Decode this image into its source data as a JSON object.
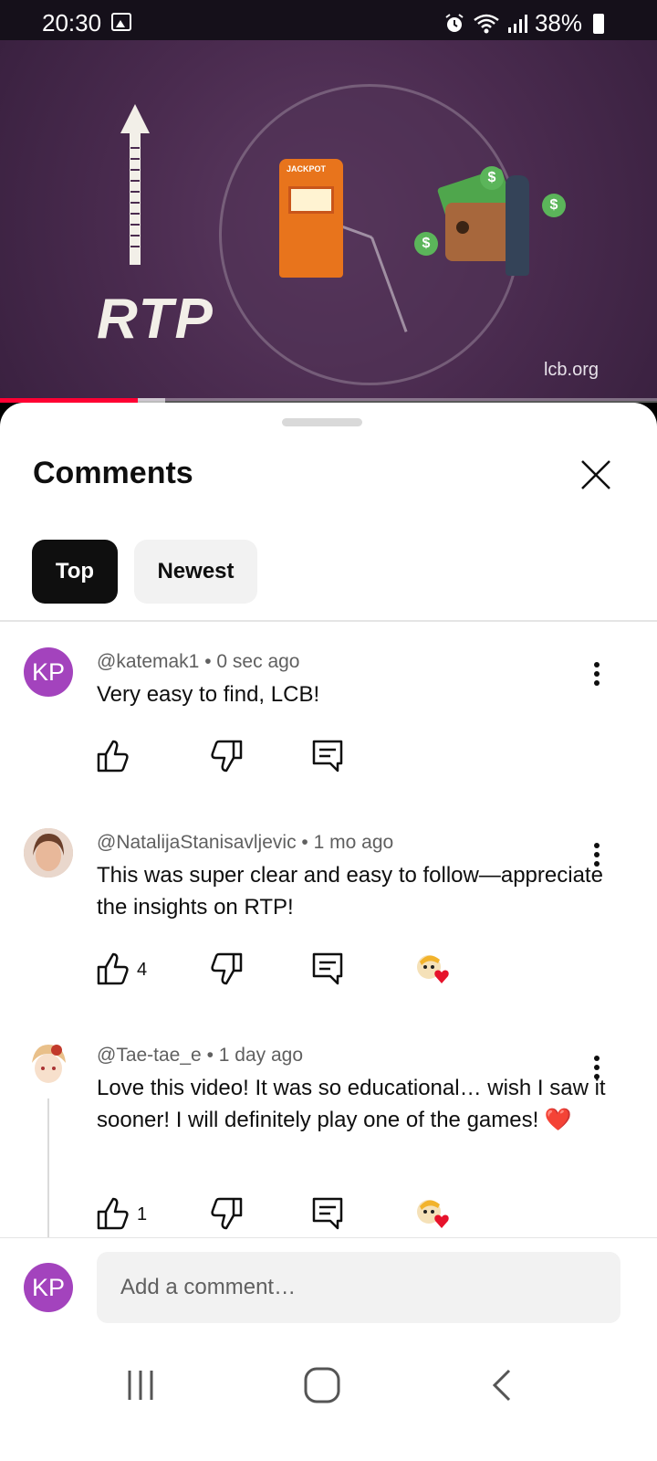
{
  "status_bar": {
    "time": "20:30",
    "battery": "38%",
    "icons": [
      "gallery-icon",
      "alarm-icon",
      "wifi-icon",
      "signal-icon",
      "battery-icon"
    ]
  },
  "video": {
    "overlay_text": "RTP",
    "slot_label": "JACKPOT",
    "watermark": "lcb.org",
    "coin_symbol": "$",
    "progress_fraction": 0.21
  },
  "comments_panel": {
    "title": "Comments",
    "tabs": [
      {
        "label": "Top",
        "selected": true
      },
      {
        "label": "Newest",
        "selected": false
      }
    ],
    "comments": [
      {
        "avatar_initials": "KP",
        "author": "@katemak1",
        "time": "0 sec ago",
        "separator": "•",
        "text": "Very easy to find, LCB!",
        "likes": ""
      },
      {
        "avatar_initials": "",
        "author": "@NatalijaStanisavljevic",
        "time": "1 mo ago",
        "separator": "•",
        "text": "This was super clear and easy to follow—appreciate the insights on RTP!",
        "likes": "4"
      },
      {
        "avatar_initials": "",
        "author": "@Tae-tae_e",
        "time": "1 day ago",
        "separator": "•",
        "text": "Love this video! It was so educational… wish I saw it sooner! I will definitely play one of the games! ❤️",
        "likes": "1"
      }
    ]
  },
  "add_comment": {
    "avatar_initials": "KP",
    "placeholder": "Add a comment…"
  },
  "colors": {
    "accent_red": "#ff0033",
    "avatar_purple": "#a343bd",
    "chip_selected": "#0f0f0f",
    "chip_default": "#f2f2f2"
  }
}
